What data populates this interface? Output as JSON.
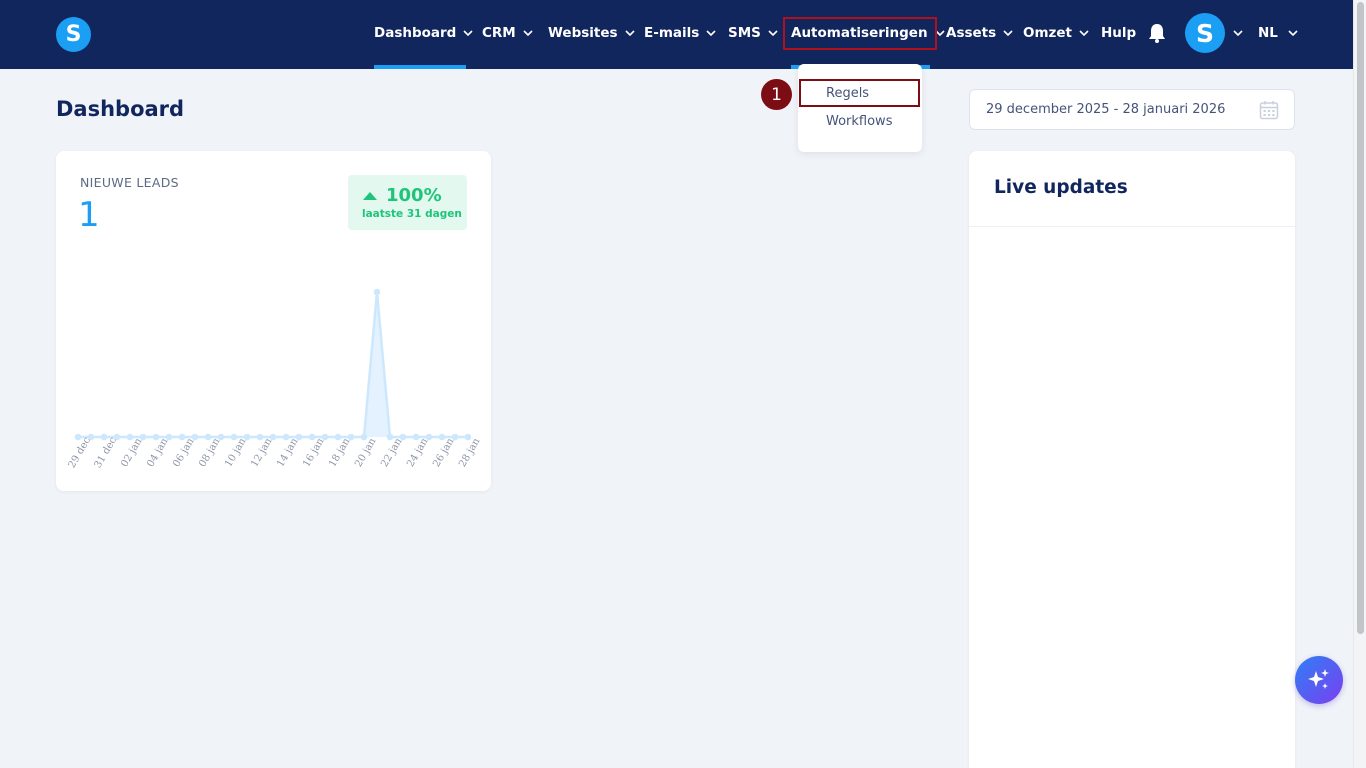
{
  "app": {
    "logo_letter": "S"
  },
  "nav": {
    "items": [
      {
        "label": "Dashboard"
      },
      {
        "label": "CRM"
      },
      {
        "label": "Websites"
      },
      {
        "label": "E-mails"
      },
      {
        "label": "SMS"
      },
      {
        "label": "Automatiseringen"
      },
      {
        "label": "Assets"
      },
      {
        "label": "Omzet"
      },
      {
        "label": "Hulp"
      }
    ],
    "avatar_letter": "S",
    "language": "NL"
  },
  "page": {
    "title": "Dashboard"
  },
  "dropdown": {
    "items": [
      "Regels",
      "Workflows"
    ],
    "step_number": "1"
  },
  "date_picker": {
    "value": "29 december 2025 - 28 januari 2026"
  },
  "leads_card": {
    "label": "NIEUWE LEADS",
    "value": "1",
    "trend_percent": "100%",
    "trend_label": "laatste 31 dagen"
  },
  "live_updates": {
    "title": "Live updates"
  },
  "colors": {
    "topbar": "#12265e",
    "accent": "#1a9ff5",
    "highlight": "#7d0d14",
    "trend": "#1fc47a"
  },
  "chart_data": {
    "type": "line",
    "x": [
      "29 dec",
      "30 dec",
      "31 dec",
      "01 jan",
      "02 jan",
      "03 jan",
      "04 jan",
      "05 jan",
      "06 jan",
      "07 jan",
      "08 jan",
      "09 jan",
      "10 jan",
      "11 jan",
      "12 jan",
      "13 jan",
      "14 jan",
      "15 jan",
      "16 jan",
      "17 jan",
      "18 jan",
      "19 jan",
      "20 jan",
      "21 jan",
      "22 jan",
      "23 jan",
      "24 jan",
      "25 jan",
      "26 jan",
      "27 jan",
      "28 jan"
    ],
    "tick_labels": [
      "29 dec",
      "31 dec",
      "02 jan",
      "04 jan",
      "06 jan",
      "08 jan",
      "10 jan",
      "12 jan",
      "14 jan",
      "16 jan",
      "18 jan",
      "20 jan",
      "22 jan",
      "24 jan",
      "26 jan",
      "28 jan"
    ],
    "series": [
      {
        "values": [
          0,
          0,
          0,
          0,
          0,
          0,
          0,
          0,
          0,
          0,
          0,
          0,
          0,
          0,
          0,
          0,
          0,
          0,
          0,
          0,
          0,
          0,
          0,
          1,
          0,
          0,
          0,
          0,
          0,
          0,
          0
        ]
      }
    ],
    "ylim": [
      0,
      1
    ],
    "grid": false,
    "xlabel": "",
    "ylabel": ""
  }
}
